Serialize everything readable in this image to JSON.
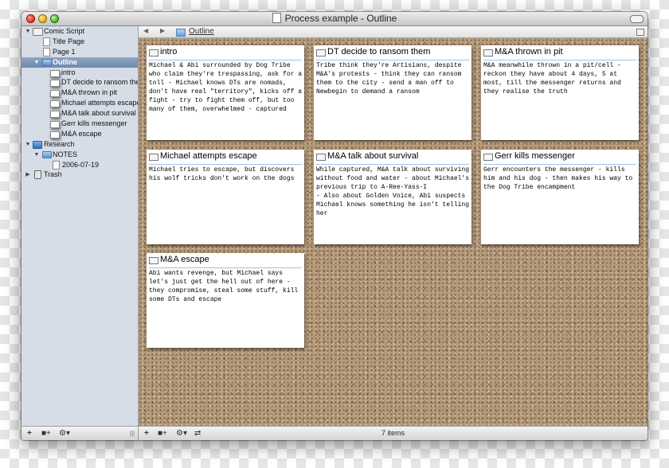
{
  "window": {
    "title": "Process example - Outline"
  },
  "sidebar": {
    "items": [
      {
        "label": "Comic Script",
        "disclosure": "▼",
        "icon": "draft-icon"
      },
      {
        "label": "Title Page",
        "disclosure": "",
        "icon": "page-icon"
      },
      {
        "label": "Page 1",
        "disclosure": "",
        "icon": "page-icon"
      },
      {
        "label": "Outline",
        "disclosure": "▼",
        "icon": "folder-icon"
      },
      {
        "label": "intro",
        "disclosure": "",
        "icon": "index-card-icon"
      },
      {
        "label": "DT decide to ransom the",
        "disclosure": "",
        "icon": "index-card-icon"
      },
      {
        "label": "M&A thrown in pit",
        "disclosure": "",
        "icon": "index-card-icon"
      },
      {
        "label": "Michael attempts escape",
        "disclosure": "",
        "icon": "index-card-icon"
      },
      {
        "label": "M&A talk about survival",
        "disclosure": "",
        "icon": "index-card-icon"
      },
      {
        "label": "Gerr kills messenger",
        "disclosure": "",
        "icon": "index-card-icon"
      },
      {
        "label": "M&A escape",
        "disclosure": "",
        "icon": "index-card-icon"
      },
      {
        "label": "Research",
        "disclosure": "▼",
        "icon": "research-folder-icon"
      },
      {
        "label": "NOTES",
        "disclosure": "▼",
        "icon": "folder-icon"
      },
      {
        "label": "2006-07-19",
        "disclosure": "",
        "icon": "page-icon"
      },
      {
        "label": "Trash",
        "disclosure": "▶",
        "icon": "trash-icon"
      }
    ],
    "bottom_buttons": {
      "add": "+",
      "add_folder": "■+",
      "gear": "⚙▾",
      "resize": "|||"
    }
  },
  "pathbar": {
    "back": "◀",
    "forward": "▶",
    "title": "Outline"
  },
  "cards": [
    {
      "title": "intro",
      "text": "Michael & Abi surrounded by Dog Tribe who claim they're trespassing, ask for a toll - Michael knows DTs are nomads, don't have real \"territory\", kicks off a fight - try to fight them off, but too many of them, overwhelmed - captured"
    },
    {
      "title": "DT decide to ransom them",
      "text": "Tribe think they're Artisians, despite M&A's protests - think they can ransom them to the city - send a man off to Newbegin to demand a ransom"
    },
    {
      "title": "M&A thrown in pit",
      "text": "M&A meanwhile thrown in a pit/cell - reckon they have about 4 days, 5 at most, till the messenger returns and they realise the truth"
    },
    {
      "title": "Michael attempts escape",
      "text": "Michael tries to escape, but discovers his wolf tricks don't work on the dogs"
    },
    {
      "title": "M&A talk about survival",
      "text": "While captured, M&A talk about surviving without food and water - about Michael's previous trip to A-Ree-Yass-I\n- Also about Golden Voice, Abi suspects Michael knows something he isn't telling her"
    },
    {
      "title": "Gerr kills messenger",
      "text": "Gerr encounters the messenger - kills him and his dog - then makes his way to the Dog Tribe encampment"
    },
    {
      "title": "M&A escape",
      "text": "Abi wants revenge, but Michael says let's just get the hell out of here - they compromise, steal some stuff, kill some DTs and escape"
    }
  ],
  "bottombar": {
    "add": "+",
    "add_folder": "■+",
    "gear": "⚙▾",
    "swap": "⇄",
    "count": "7 items"
  }
}
